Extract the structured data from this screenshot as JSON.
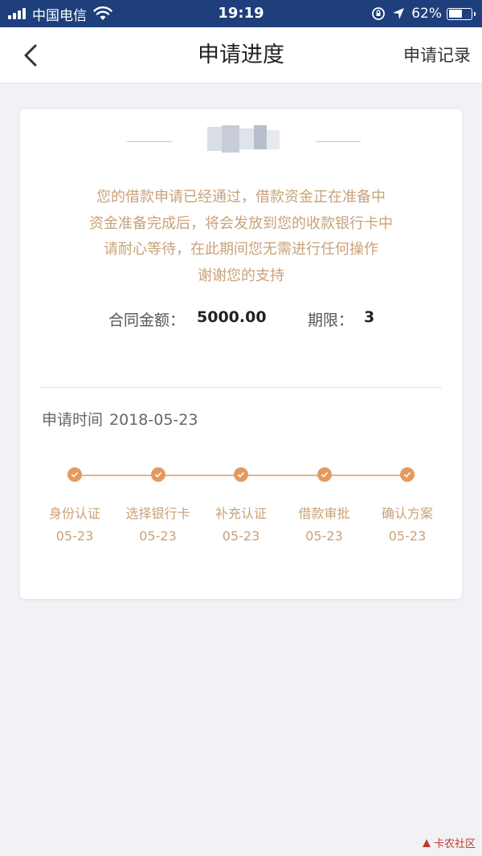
{
  "status_bar": {
    "carrier": "中国电信",
    "time": "19:19",
    "battery_percent": "62%",
    "battery_level": 0.62
  },
  "nav": {
    "title": "申请进度",
    "right_link": "申请记录"
  },
  "card": {
    "message_lines": [
      "您的借款申请已经通过，借款资金正在准备中",
      "资金准备完成后，将会发放到您的收款银行卡中",
      "请耐心等待，在此期间您无需进行任何操作",
      "谢谢您的支持"
    ],
    "contract_amount_label": "合同金额：",
    "contract_amount_value": "5000.00",
    "term_label": "期限：",
    "term_value": "3",
    "apply_time_label": "申请时间",
    "apply_time_value": "2018-05-23",
    "steps": [
      {
        "label": "身份认证",
        "date": "05-23"
      },
      {
        "label": "选择银行卡",
        "date": "05-23"
      },
      {
        "label": "补充认证",
        "date": "05-23"
      },
      {
        "label": "借款审批",
        "date": "05-23"
      },
      {
        "label": "确认方案",
        "date": "05-23"
      }
    ]
  },
  "watermark": {
    "text": "卡农社区"
  },
  "colors": {
    "status_bar": "#1e3f7c",
    "accent": "#e39a61",
    "message_text": "#c9a27a"
  }
}
